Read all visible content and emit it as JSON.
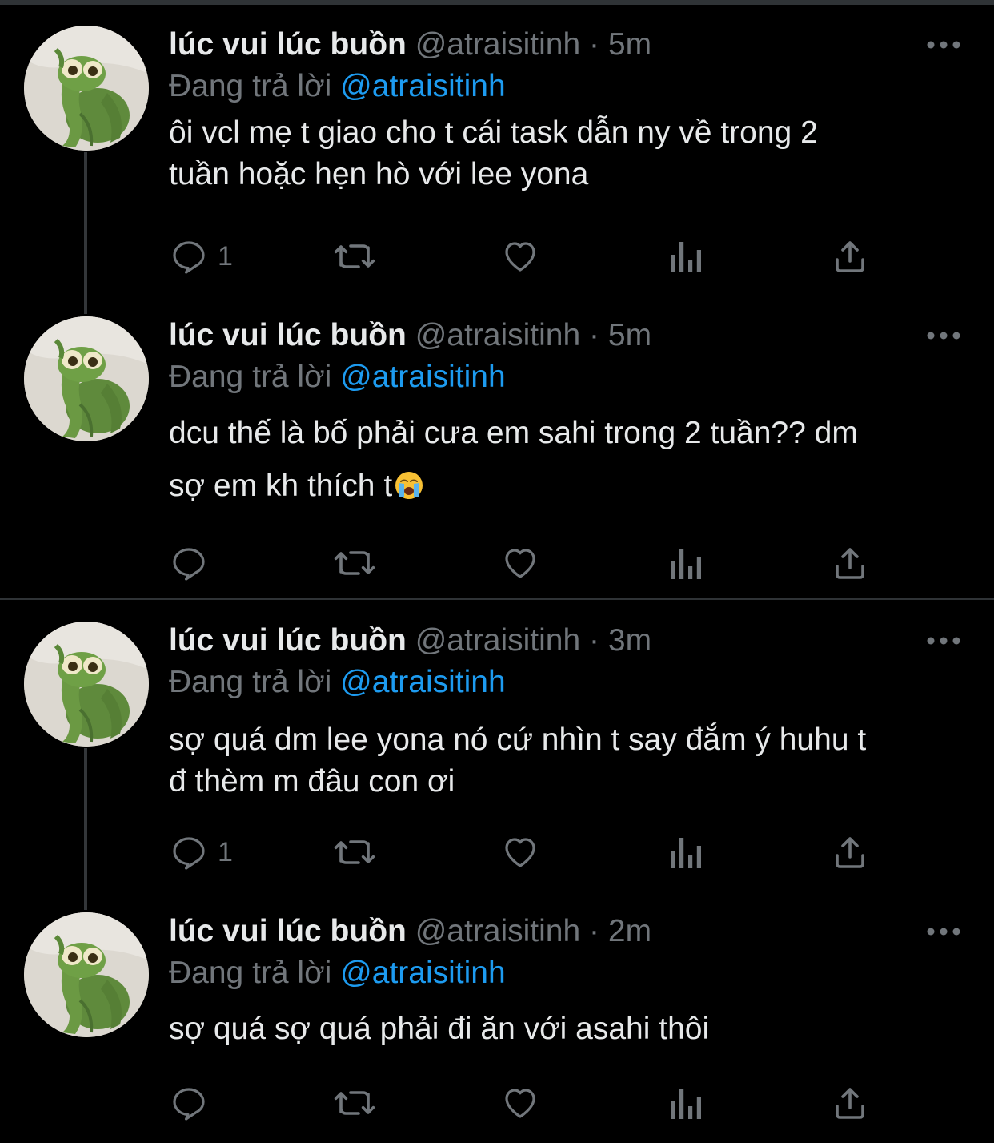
{
  "colors": {
    "background": "#000000",
    "text_primary": "#e7e9ea",
    "text_secondary": "#71767b",
    "accent": "#1d9bf0",
    "divider": "#2f3336"
  },
  "tweets": [
    {
      "name": "lúc vui lúc buồn",
      "handle": "@atraisitinh",
      "separator": "·",
      "time": "5m",
      "reply_prefix": "Đang trả lời",
      "reply_to": "@atraisitinh",
      "lines": [
        "ôi vcl mẹ t giao cho t cái task dẫn ny về trong 2",
        "tuần hoặc hẹn hò với lee yona"
      ],
      "reply_count": "1",
      "icons": [
        "reply-icon",
        "retweet-icon",
        "like-icon",
        "analytics-icon",
        "share-icon"
      ]
    },
    {
      "name": "lúc vui lúc buồn",
      "handle": "@atraisitinh",
      "separator": "·",
      "time": "5m",
      "reply_prefix": "Đang trả lời",
      "reply_to": "@atraisitinh",
      "lines": [
        "dcu thế là bố phải cưa em sahi trong 2 tuần?? dm",
        "sợ em kh thích t"
      ],
      "trailing_emoji": "loudly-crying-face",
      "reply_count": "",
      "icons": [
        "reply-icon",
        "retweet-icon",
        "like-icon",
        "analytics-icon",
        "share-icon"
      ]
    },
    {
      "name": "lúc vui lúc buồn",
      "handle": "@atraisitinh",
      "separator": "·",
      "time": "3m",
      "reply_prefix": "Đang trả lời",
      "reply_to": "@atraisitinh",
      "lines": [
        "sợ quá dm lee yona nó cứ nhìn t say đắm ý huhu t",
        "đ thèm m đâu con ơi"
      ],
      "reply_count": "1",
      "icons": [
        "reply-icon",
        "retweet-icon",
        "like-icon",
        "analytics-icon",
        "share-icon"
      ]
    },
    {
      "name": "lúc vui lúc buồn",
      "handle": "@atraisitinh",
      "separator": "·",
      "time": "2m",
      "reply_prefix": "Đang trả lời",
      "reply_to": "@atraisitinh",
      "lines": [
        "sợ quá sợ quá phải đi ăn với asahi thôi"
      ],
      "reply_count": "",
      "icons": [
        "reply-icon",
        "retweet-icon",
        "like-icon",
        "analytics-icon",
        "share-icon"
      ]
    }
  ]
}
